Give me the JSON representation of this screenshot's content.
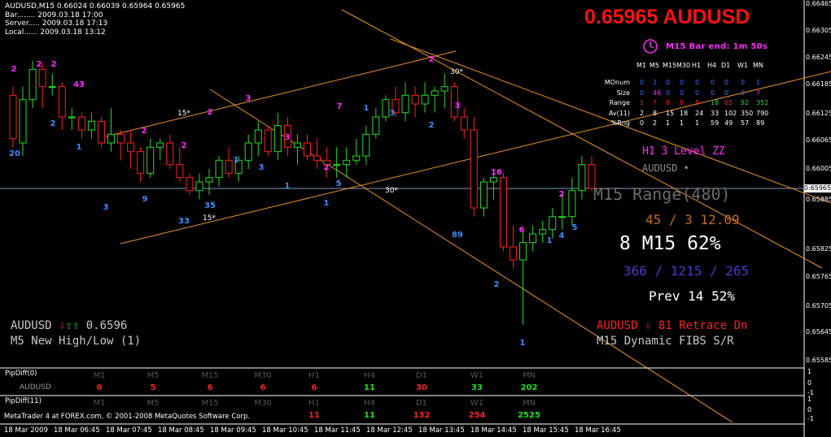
{
  "header_lines": [
    "AUDUSD,M15  0.66024 0.66039 0.65964 0.65965",
    "Bar........ 2009.03.18 17:00",
    "Server..... 2009.03.18 17:13",
    "Local...... 2009.03.18 13:12"
  ],
  "big_price": "0.65965 AUDUSD",
  "bar_end": "M15 Bar end: 1m 50s",
  "timeframes": [
    "M1",
    "M5",
    "M15",
    "M30",
    "H1",
    "H4",
    "D1",
    "W1",
    "MN"
  ],
  "info_rows": [
    {
      "label": "MOnum",
      "values": [
        "0",
        "2",
        "0",
        "0",
        "0",
        "0",
        "0",
        "0",
        "1"
      ]
    },
    {
      "label": "Size",
      "values": [
        "0",
        "46",
        "0",
        "0",
        "0",
        "0",
        "0",
        "0",
        "7"
      ]
    },
    {
      "label": "Range",
      "values": [
        "1",
        "7",
        "8",
        "8",
        "8",
        "18",
        "65",
        "92",
        "352"
      ]
    },
    {
      "label": "Av(11)",
      "values": [
        "2",
        "8",
        "15",
        "18",
        "24",
        "33",
        "102",
        "350",
        "790"
      ]
    },
    {
      "label": "%Rng",
      "values": [
        "0",
        "2",
        "1",
        "1",
        "1",
        "59",
        "49",
        "57",
        "89"
      ]
    }
  ],
  "info_colors": {
    "red": "#ff2020",
    "blue": "#3a6cff",
    "green": "#22dd22",
    "white": "#ffffff",
    "yellow": "#ffd34d",
    "magenta": "#ff20ff"
  },
  "h1_zz": "H1 3 Level ZZ",
  "symbol_dot": "AUDUSD •",
  "range_label": "M15 Range(480)",
  "range_vals": "45 / 3   12.09",
  "pct_line": "8  M15 62%",
  "counts_line": "366 / 1215 / 265",
  "prev_line": "Prev 14   52%",
  "retrace": "AUDUSD ⇩ 81 Retrace Dn",
  "fibs": "M15 Dynamic FIBS S/R",
  "left_symbol": "AUDUSD",
  "left_price": "0.6596",
  "left_newhl": "M5 New High/Low (1)",
  "angle_labels": [
    "15*",
    "15*",
    "30*",
    "30*"
  ],
  "price_axis": [
    "0.66465",
    "0.66305",
    "0.66245",
    "0.66185",
    "0.66125",
    "0.66065",
    "0.66005",
    "0.65965",
    "0.65885",
    "0.65825",
    "0.65765",
    "0.65705",
    "0.65645",
    "0.65585"
  ],
  "current_price_tag": "0.65965",
  "time_axis": [
    "18 Mar 2009",
    "18 Mar 06:45",
    "18 Mar 07:45",
    "18 Mar 08:45",
    "18 Mar 09:45",
    "18 Mar 10:45",
    "18 Mar 11:45",
    "18 Mar 12:45",
    "18 Mar 13:45",
    "18 Mar 14:45",
    "18 Mar 15:45",
    "18 Mar 16:45"
  ],
  "pipdiff0": {
    "title": "PipDiff(0)",
    "sub": "AUDUSD",
    "values": [
      "0",
      "5",
      "6",
      "6",
      "6",
      "11",
      "30",
      "33",
      "202"
    ]
  },
  "pipdiff11": {
    "title": "PipDiff(11)",
    "values": [
      "",
      "",
      "",
      "",
      "11",
      "11",
      "132",
      "254",
      "2525"
    ]
  },
  "copyright": "MetaTrader 4 at FOREX.com, © 2001-2008 MetaQuotes Software Corp.",
  "sub_axis": [
    "1",
    "0",
    "-1",
    "1",
    "0",
    "-1"
  ],
  "chart_data": {
    "type": "candlestick",
    "candles": [
      {
        "o": 0.6618,
        "h": 0.662,
        "l": 0.6606,
        "c": 0.6608
      },
      {
        "o": 0.6607,
        "h": 0.662,
        "l": 0.6604,
        "c": 0.6617
      },
      {
        "o": 0.6617,
        "h": 0.6626,
        "l": 0.6615,
        "c": 0.6624
      },
      {
        "o": 0.6624,
        "h": 0.66255,
        "l": 0.6615,
        "c": 0.662
      },
      {
        "o": 0.662,
        "h": 0.6623,
        "l": 0.6618,
        "c": 0.662
      },
      {
        "o": 0.662,
        "h": 0.6621,
        "l": 0.661,
        "c": 0.6613
      },
      {
        "o": 0.6613,
        "h": 0.6615,
        "l": 0.661,
        "c": 0.6613
      },
      {
        "o": 0.6613,
        "h": 0.6614,
        "l": 0.6608,
        "c": 0.661
      },
      {
        "o": 0.661,
        "h": 0.6614,
        "l": 0.6608,
        "c": 0.6612
      },
      {
        "o": 0.6612,
        "h": 0.6613,
        "l": 0.6606,
        "c": 0.6607
      },
      {
        "o": 0.6607,
        "h": 0.6615,
        "l": 0.6605,
        "c": 0.6609
      },
      {
        "o": 0.6609,
        "h": 0.661,
        "l": 0.6603,
        "c": 0.6607
      },
      {
        "o": 0.6607,
        "h": 0.661,
        "l": 0.6601,
        "c": 0.6605
      },
      {
        "o": 0.6605,
        "h": 0.6606,
        "l": 0.6598,
        "c": 0.66
      },
      {
        "o": 0.66,
        "h": 0.6608,
        "l": 0.6599,
        "c": 0.6606
      },
      {
        "o": 0.6606,
        "h": 0.6608,
        "l": 0.6603,
        "c": 0.6607
      },
      {
        "o": 0.6607,
        "h": 0.6609,
        "l": 0.6601,
        "c": 0.6602
      },
      {
        "o": 0.6602,
        "h": 0.6606,
        "l": 0.6598,
        "c": 0.6599
      },
      {
        "o": 0.6599,
        "h": 0.66,
        "l": 0.6595,
        "c": 0.6596
      },
      {
        "o": 0.6596,
        "h": 0.66,
        "l": 0.6594,
        "c": 0.6598
      },
      {
        "o": 0.6598,
        "h": 0.6601,
        "l": 0.6595,
        "c": 0.6599
      },
      {
        "o": 0.6599,
        "h": 0.6604,
        "l": 0.6597,
        "c": 0.6603
      },
      {
        "o": 0.6603,
        "h": 0.6606,
        "l": 0.6599,
        "c": 0.66
      },
      {
        "o": 0.66,
        "h": 0.6604,
        "l": 0.6598,
        "c": 0.6603
      },
      {
        "o": 0.6603,
        "h": 0.6609,
        "l": 0.6601,
        "c": 0.6607
      },
      {
        "o": 0.6607,
        "h": 0.6612,
        "l": 0.6604,
        "c": 0.661
      },
      {
        "o": 0.661,
        "h": 0.6611,
        "l": 0.6604,
        "c": 0.6605
      },
      {
        "o": 0.6605,
        "h": 0.6614,
        "l": 0.6603,
        "c": 0.6611
      },
      {
        "o": 0.6611,
        "h": 0.6613,
        "l": 0.6604,
        "c": 0.6606
      },
      {
        "o": 0.6606,
        "h": 0.6609,
        "l": 0.6602,
        "c": 0.6607
      },
      {
        "o": 0.6607,
        "h": 0.6609,
        "l": 0.6603,
        "c": 0.6604
      },
      {
        "o": 0.6604,
        "h": 0.6608,
        "l": 0.6601,
        "c": 0.6603
      },
      {
        "o": 0.6603,
        "h": 0.6606,
        "l": 0.6599,
        "c": 0.6602
      },
      {
        "o": 0.6602,
        "h": 0.6606,
        "l": 0.6599,
        "c": 0.6602
      },
      {
        "o": 0.6602,
        "h": 0.6606,
        "l": 0.6599,
        "c": 0.6603
      },
      {
        "o": 0.6603,
        "h": 0.6608,
        "l": 0.6602,
        "c": 0.6604
      },
      {
        "o": 0.6604,
        "h": 0.6611,
        "l": 0.6602,
        "c": 0.6609
      },
      {
        "o": 0.6609,
        "h": 0.6615,
        "l": 0.6608,
        "c": 0.6613
      },
      {
        "o": 0.6613,
        "h": 0.6618,
        "l": 0.6612,
        "c": 0.6617
      },
      {
        "o": 0.6617,
        "h": 0.662,
        "l": 0.6613,
        "c": 0.6614
      },
      {
        "o": 0.6614,
        "h": 0.6621,
        "l": 0.6612,
        "c": 0.6618
      },
      {
        "o": 0.6618,
        "h": 0.662,
        "l": 0.6613,
        "c": 0.6616
      },
      {
        "o": 0.6616,
        "h": 0.6621,
        "l": 0.6614,
        "c": 0.6618
      },
      {
        "o": 0.6618,
        "h": 0.662,
        "l": 0.6614,
        "c": 0.6619
      },
      {
        "o": 0.6619,
        "h": 0.6623,
        "l": 0.6615,
        "c": 0.662
      },
      {
        "o": 0.662,
        "h": 0.6621,
        "l": 0.6612,
        "c": 0.6613
      },
      {
        "o": 0.6613,
        "h": 0.6615,
        "l": 0.6608,
        "c": 0.661
      },
      {
        "o": 0.661,
        "h": 0.6613,
        "l": 0.659,
        "c": 0.6592
      },
      {
        "o": 0.6592,
        "h": 0.6599,
        "l": 0.659,
        "c": 0.6598
      },
      {
        "o": 0.6598,
        "h": 0.6601,
        "l": 0.6594,
        "c": 0.6599
      },
      {
        "o": 0.6599,
        "h": 0.66,
        "l": 0.6582,
        "c": 0.6583
      },
      {
        "o": 0.6583,
        "h": 0.6588,
        "l": 0.6578,
        "c": 0.658
      },
      {
        "o": 0.658,
        "h": 0.6587,
        "l": 0.6565,
        "c": 0.6584
      },
      {
        "o": 0.6584,
        "h": 0.6588,
        "l": 0.6582,
        "c": 0.6586
      },
      {
        "o": 0.6586,
        "h": 0.6589,
        "l": 0.6584,
        "c": 0.6587
      },
      {
        "o": 0.6587,
        "h": 0.6592,
        "l": 0.6585,
        "c": 0.659
      },
      {
        "o": 0.659,
        "h": 0.6596,
        "l": 0.6587,
        "c": 0.659
      },
      {
        "o": 0.659,
        "h": 0.6599,
        "l": 0.6588,
        "c": 0.6596
      },
      {
        "o": 0.6596,
        "h": 0.6604,
        "l": 0.6594,
        "c": 0.6602
      },
      {
        "o": 0.6602,
        "h": 0.6604,
        "l": 0.6596,
        "c": 0.65965
      }
    ]
  }
}
